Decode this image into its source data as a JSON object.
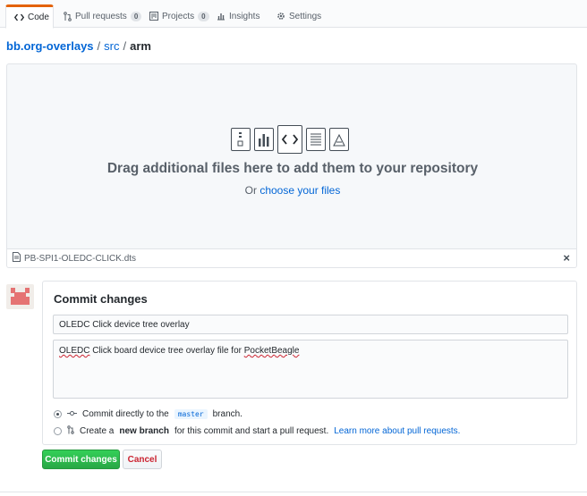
{
  "tabs": [
    {
      "label": "Code",
      "icon": "code-icon",
      "selected": true
    },
    {
      "label": "Pull requests",
      "icon": "pull-request-icon",
      "count": "0"
    },
    {
      "label": "Projects",
      "icon": "project-icon",
      "count": "0"
    },
    {
      "label": "Insights",
      "icon": "graph-icon"
    },
    {
      "label": "Settings",
      "icon": "gear-icon"
    }
  ],
  "breadcrumb": {
    "repo": "bb.org-overlays",
    "sep1": "/",
    "dir": "src",
    "sep2": "/",
    "current": "arm"
  },
  "dropzone": {
    "title": "Drag additional files here to add them to your repository",
    "prefix": "Or",
    "link": "choose your files",
    "icons": [
      "file-zip-icon",
      "file-chart-icon",
      "file-code-icon",
      "file-text-icon",
      "file-pdf-icon"
    ]
  },
  "file": {
    "name": "PB-SPI1-OLEDC-CLICK.dts",
    "close": "×"
  },
  "commit": {
    "heading": "Commit changes",
    "title_value": "OLEDC Click device tree overlay",
    "desc_word1": "OLEDC",
    "desc_mid": " Click board device tree overlay file for ",
    "desc_word2": "PocketBeagle",
    "option1_text": "Commit directly to the",
    "option1_branch": "master",
    "option1_suffix": "branch.",
    "option2_prefix": "Create a",
    "option2_bold": "new branch",
    "option2_text": "for this commit and start a pull request.",
    "option2_link": "Learn more about pull requests.",
    "submit_label": "Commit changes",
    "cancel_label": "Cancel"
  },
  "colors": {
    "accent": "#0366d6",
    "submit": "#28a745",
    "cancel": "#cb2431",
    "tab_indicator": "#e36209"
  }
}
